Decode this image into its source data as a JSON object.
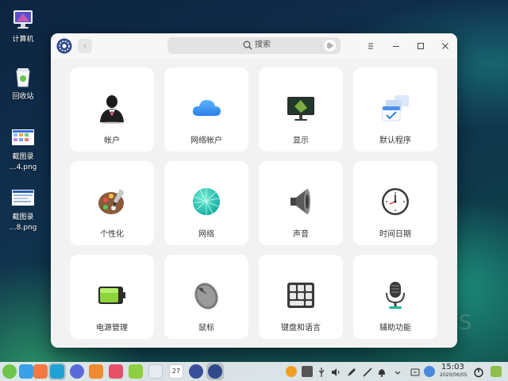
{
  "desktop": {
    "icons": [
      {
        "label": "计算机"
      },
      {
        "label": "回收站"
      },
      {
        "label": "截图录",
        "label2": "…4.png"
      },
      {
        "label": "截图录",
        "label2": "…8.png"
      }
    ]
  },
  "window": {
    "search_placeholder": "搜索",
    "cards": [
      {
        "label": "帐户"
      },
      {
        "label": "网络帐户"
      },
      {
        "label": "显示"
      },
      {
        "label": "默认程序"
      },
      {
        "label": "个性化"
      },
      {
        "label": "网络"
      },
      {
        "label": "声音"
      },
      {
        "label": "时间日期"
      },
      {
        "label": "电源管理"
      },
      {
        "label": "鼠标"
      },
      {
        "label": "键盘和语言"
      },
      {
        "label": "辅助功能"
      }
    ]
  },
  "watermark": "S",
  "taskbar": {
    "time": "15:03",
    "date": "2020/06/05"
  },
  "colors": {
    "accent": "#2c7be5",
    "card_bg": "#ffffff",
    "window_bg": "#f2f2f2"
  }
}
